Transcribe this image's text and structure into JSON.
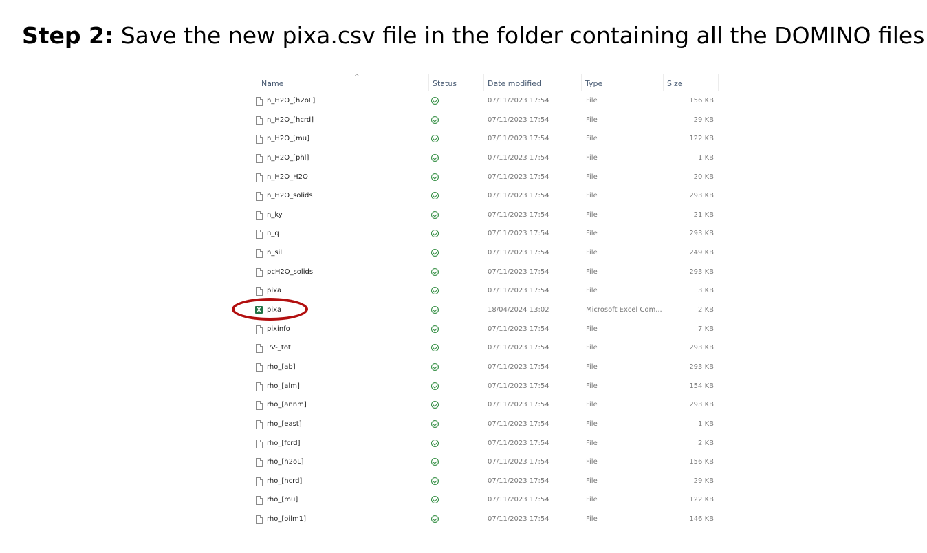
{
  "heading": {
    "lead": "Step 2:",
    "text": " Save the new pixa.csv file in the folder containing all the DOMINO files"
  },
  "columns": {
    "name": "Name",
    "status": "Status",
    "date": "Date modified",
    "type": "Type",
    "size": "Size"
  },
  "sort_indicator": "^",
  "files": [
    {
      "name": "n_H2O_[h2oL]",
      "date": "07/11/2023 17:54",
      "type": "File",
      "size": "156 KB",
      "icon": "file-icon"
    },
    {
      "name": "n_H2O_[hcrd]",
      "date": "07/11/2023 17:54",
      "type": "File",
      "size": "29 KB",
      "icon": "file-icon"
    },
    {
      "name": "n_H2O_[mu]",
      "date": "07/11/2023 17:54",
      "type": "File",
      "size": "122 KB",
      "icon": "file-icon"
    },
    {
      "name": "n_H2O_[phl]",
      "date": "07/11/2023 17:54",
      "type": "File",
      "size": "1 KB",
      "icon": "file-icon"
    },
    {
      "name": "n_H2O_H2O",
      "date": "07/11/2023 17:54",
      "type": "File",
      "size": "20 KB",
      "icon": "file-icon"
    },
    {
      "name": "n_H2O_solids",
      "date": "07/11/2023 17:54",
      "type": "File",
      "size": "293 KB",
      "icon": "file-icon"
    },
    {
      "name": "n_ky",
      "date": "07/11/2023 17:54",
      "type": "File",
      "size": "21 KB",
      "icon": "file-icon"
    },
    {
      "name": "n_q",
      "date": "07/11/2023 17:54",
      "type": "File",
      "size": "293 KB",
      "icon": "file-icon"
    },
    {
      "name": "n_sill",
      "date": "07/11/2023 17:54",
      "type": "File",
      "size": "249 KB",
      "icon": "file-icon"
    },
    {
      "name": "pcH2O_solids",
      "date": "07/11/2023 17:54",
      "type": "File",
      "size": "293 KB",
      "icon": "file-icon"
    },
    {
      "name": "pixa",
      "date": "07/11/2023 17:54",
      "type": "File",
      "size": "3 KB",
      "icon": "file-icon"
    },
    {
      "name": "pixa",
      "date": "18/04/2024 13:02",
      "type": "Microsoft Excel Com...",
      "size": "2 KB",
      "icon": "excel-icon"
    },
    {
      "name": "pixinfo",
      "date": "07/11/2023 17:54",
      "type": "File",
      "size": "7 KB",
      "icon": "file-icon"
    },
    {
      "name": "PV-_tot",
      "date": "07/11/2023 17:54",
      "type": "File",
      "size": "293 KB",
      "icon": "file-icon"
    },
    {
      "name": "rho_[ab]",
      "date": "07/11/2023 17:54",
      "type": "File",
      "size": "293 KB",
      "icon": "file-icon"
    },
    {
      "name": "rho_[alm]",
      "date": "07/11/2023 17:54",
      "type": "File",
      "size": "154 KB",
      "icon": "file-icon"
    },
    {
      "name": "rho_[annm]",
      "date": "07/11/2023 17:54",
      "type": "File",
      "size": "293 KB",
      "icon": "file-icon"
    },
    {
      "name": "rho_[east]",
      "date": "07/11/2023 17:54",
      "type": "File",
      "size": "1 KB",
      "icon": "file-icon"
    },
    {
      "name": "rho_[fcrd]",
      "date": "07/11/2023 17:54",
      "type": "File",
      "size": "2 KB",
      "icon": "file-icon"
    },
    {
      "name": "rho_[h2oL]",
      "date": "07/11/2023 17:54",
      "type": "File",
      "size": "156 KB",
      "icon": "file-icon"
    },
    {
      "name": "rho_[hcrd]",
      "date": "07/11/2023 17:54",
      "type": "File",
      "size": "29 KB",
      "icon": "file-icon"
    },
    {
      "name": "rho_[mu]",
      "date": "07/11/2023 17:54",
      "type": "File",
      "size": "122 KB",
      "icon": "file-icon"
    },
    {
      "name": "rho_[oilm1]",
      "date": "07/11/2023 17:54",
      "type": "File",
      "size": "146 KB",
      "icon": "file-icon"
    }
  ],
  "status_icon": "synced-check-icon",
  "excel_icon_letter": "X",
  "highlight": {
    "row_index": 11,
    "color": "#b20f0f"
  }
}
